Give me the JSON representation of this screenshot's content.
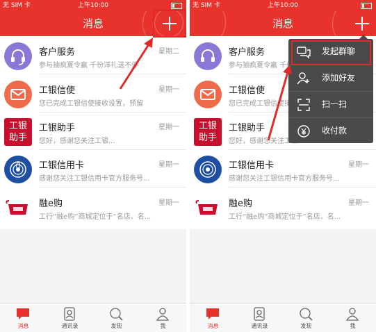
{
  "statusbar": {
    "carrier": "无 SIM 卡",
    "time": "上午10:00"
  },
  "navbar": {
    "title": "消息"
  },
  "conversations": [
    {
      "name": "客户服务",
      "time": "星期二",
      "preview": "参与抽疯夏令赢  千份洋礼送不停"
    },
    {
      "name": "工银信使",
      "time": "星期一",
      "preview": "您已完成工银信使接收设置，预留"
    },
    {
      "name": "工银助手",
      "time": "星期一",
      "preview": "您好，感谢您关注工银..."
    },
    {
      "name": "工银信用卡",
      "time": "星期一",
      "preview": "感谢您关注工银信用卡官方服务号..."
    },
    {
      "name": "融e购",
      "time": "星期一",
      "preview": "工行“融e购”商城定位于“名店、名..."
    }
  ],
  "popup_menu": [
    {
      "label": "发起群聊",
      "icon": "group-chat-icon"
    },
    {
      "label": "添加好友",
      "icon": "add-friend-icon"
    },
    {
      "label": "扫一扫",
      "icon": "scan-icon"
    },
    {
      "label": "收付款",
      "icon": "payment-icon"
    }
  ],
  "tabs": [
    {
      "label": "消息",
      "icon": "message-icon"
    },
    {
      "label": "通讯录",
      "icon": "contacts-icon"
    },
    {
      "label": "发现",
      "icon": "discover-icon"
    },
    {
      "label": "我",
      "icon": "profile-icon"
    }
  ],
  "avatar_text": {
    "assistant_line1": "工银",
    "assistant_line2": "助手"
  },
  "colors": {
    "brand_red": "#e8332c",
    "callout_red": "#e02a2a",
    "menu_bg": "#4a4a4a",
    "service_purple": "#8a77d6",
    "card_blue": "#1f4fa3"
  }
}
